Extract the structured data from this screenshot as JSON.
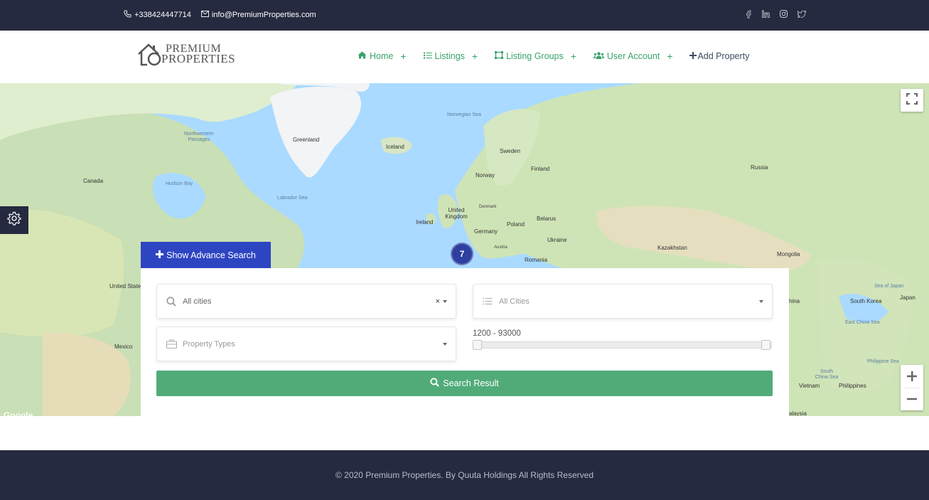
{
  "topbar": {
    "phone": "+338424447714",
    "email": "info@PremiumProperties.com",
    "social": [
      "facebook-icon",
      "linkedin-icon",
      "instagram-icon",
      "twitter-icon"
    ]
  },
  "header": {
    "logo_line1": "PREMIUM",
    "logo_line2": "PROPERTIES",
    "nav": [
      {
        "label": "Home",
        "icon": "home-icon",
        "expand": "+"
      },
      {
        "label": "Listings",
        "icon": "list-icon",
        "expand": "+"
      },
      {
        "label": "Listing Groups",
        "icon": "group-icon",
        "expand": "+"
      },
      {
        "label": "User Account",
        "icon": "users-icon",
        "expand": "+"
      },
      {
        "label": "Add Property",
        "icon": "plus-icon"
      }
    ]
  },
  "map": {
    "cluster_count": "7",
    "attribution": "Google",
    "labels": {
      "greenland": "Greenland",
      "iceland": "Iceland",
      "norwegian_sea": "Norwegian Sea",
      "sweden": "Sweden",
      "finland": "Finland",
      "norway": "Norway",
      "russia": "Russia",
      "canada": "Canada",
      "hudson_bay": "Hudson Bay",
      "labrador_sea": "Labrador Sea",
      "northwestern_passages": "Northwestern Passages",
      "united_kingdom": "United Kingdom",
      "ireland": "Ireland",
      "denmark": "Denmark",
      "belarus": "Belarus",
      "poland": "Poland",
      "germany": "Germany",
      "ukraine": "Ukraine",
      "austria": "Austria",
      "romania": "Romania",
      "kazakhstan": "Kazakhstan",
      "mongolia": "Mongolia",
      "united_states": "United States",
      "mexico": "Mexico",
      "sea_of_japan": "Sea of Japan",
      "south_korea": "South Korea",
      "japan": "Japan",
      "east_china_sea": "East China Sea",
      "philippine_sea": "Philippine Sea",
      "south_china_sea": "South China Sea",
      "vietnam": "Vietnam",
      "philippines": "Philippines",
      "china": "hina",
      "malaysia": "alaysia"
    }
  },
  "search": {
    "advance_button": "Show Advance Search",
    "city_value": "All cities",
    "city_clear": "×",
    "cities_placeholder": "All Cities",
    "types_placeholder": "Property Types",
    "price_range": "1200 - 93000",
    "price_min_fraction": 0,
    "price_max_fraction": 1,
    "submit": "Search Result"
  },
  "footer": {
    "copyright": "© 2020 Premium Properties. By Quuta Holdings All Rights Reserved"
  },
  "colors": {
    "dark": "#262a40",
    "green": "#3aa36a",
    "button_blue": "#2e45c2",
    "button_green": "#51ab79",
    "cluster": "#2e3fa0"
  }
}
